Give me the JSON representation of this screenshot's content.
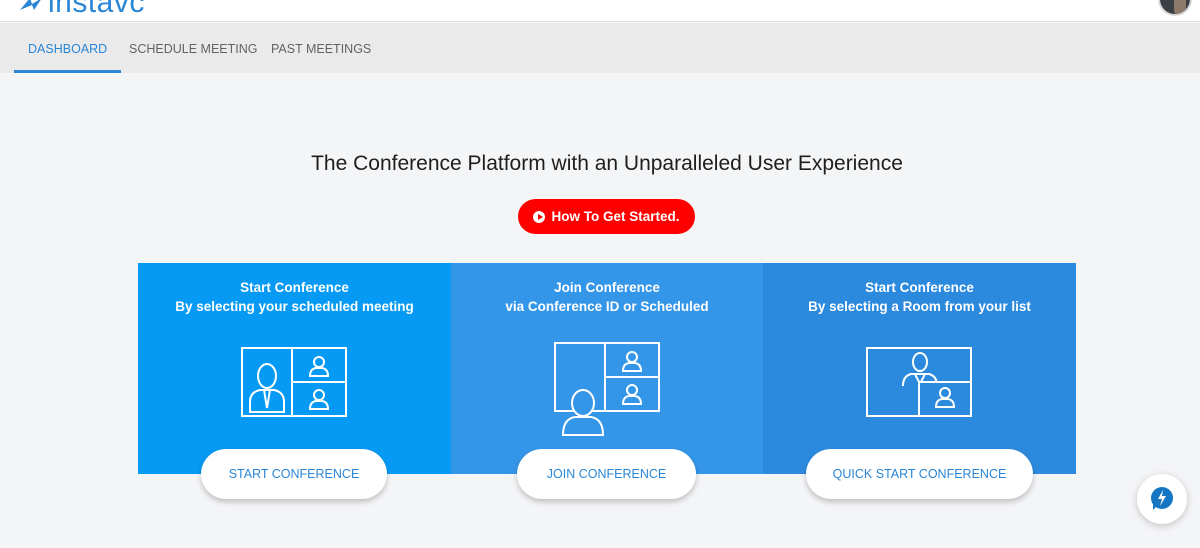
{
  "header": {
    "logo_text": "instavc",
    "logo_icon": "instavc-logo-icon",
    "avatar_icon": "user-avatar-icon"
  },
  "tabs": [
    {
      "label": "DASHBOARD",
      "active": true
    },
    {
      "label": "SCHEDULE MEETING",
      "active": false
    },
    {
      "label": "PAST MEETINGS",
      "active": false
    }
  ],
  "main": {
    "headline": "The Conference Platform with an Unparalleled User Experience",
    "cta_label": "How To Get Started.",
    "cta_icon": "play-circle-icon"
  },
  "cards": [
    {
      "title": "Start Conference",
      "subtitle": "By selecting your scheduled meeting",
      "button": "START CONFERENCE",
      "icon": "scheduled-conference-icon",
      "color": "#069af4"
    },
    {
      "title": "Join Conference",
      "subtitle": "via Conference ID or Scheduled",
      "button": "JOIN CONFERENCE",
      "icon": "join-conference-icon",
      "color": "#3496e9"
    },
    {
      "title": "Start Conference",
      "subtitle": "By selecting a Room from your list",
      "button": "QUICK START CONFERENCE",
      "icon": "room-conference-icon",
      "color": "#2c8ade"
    }
  ],
  "help_widget": {
    "icon": "lightning-chat-icon"
  },
  "colors": {
    "accent": "#2a86d6",
    "cta": "#ff0000",
    "background": "#f4f5f7",
    "tabbar": "#eaeaeb"
  }
}
